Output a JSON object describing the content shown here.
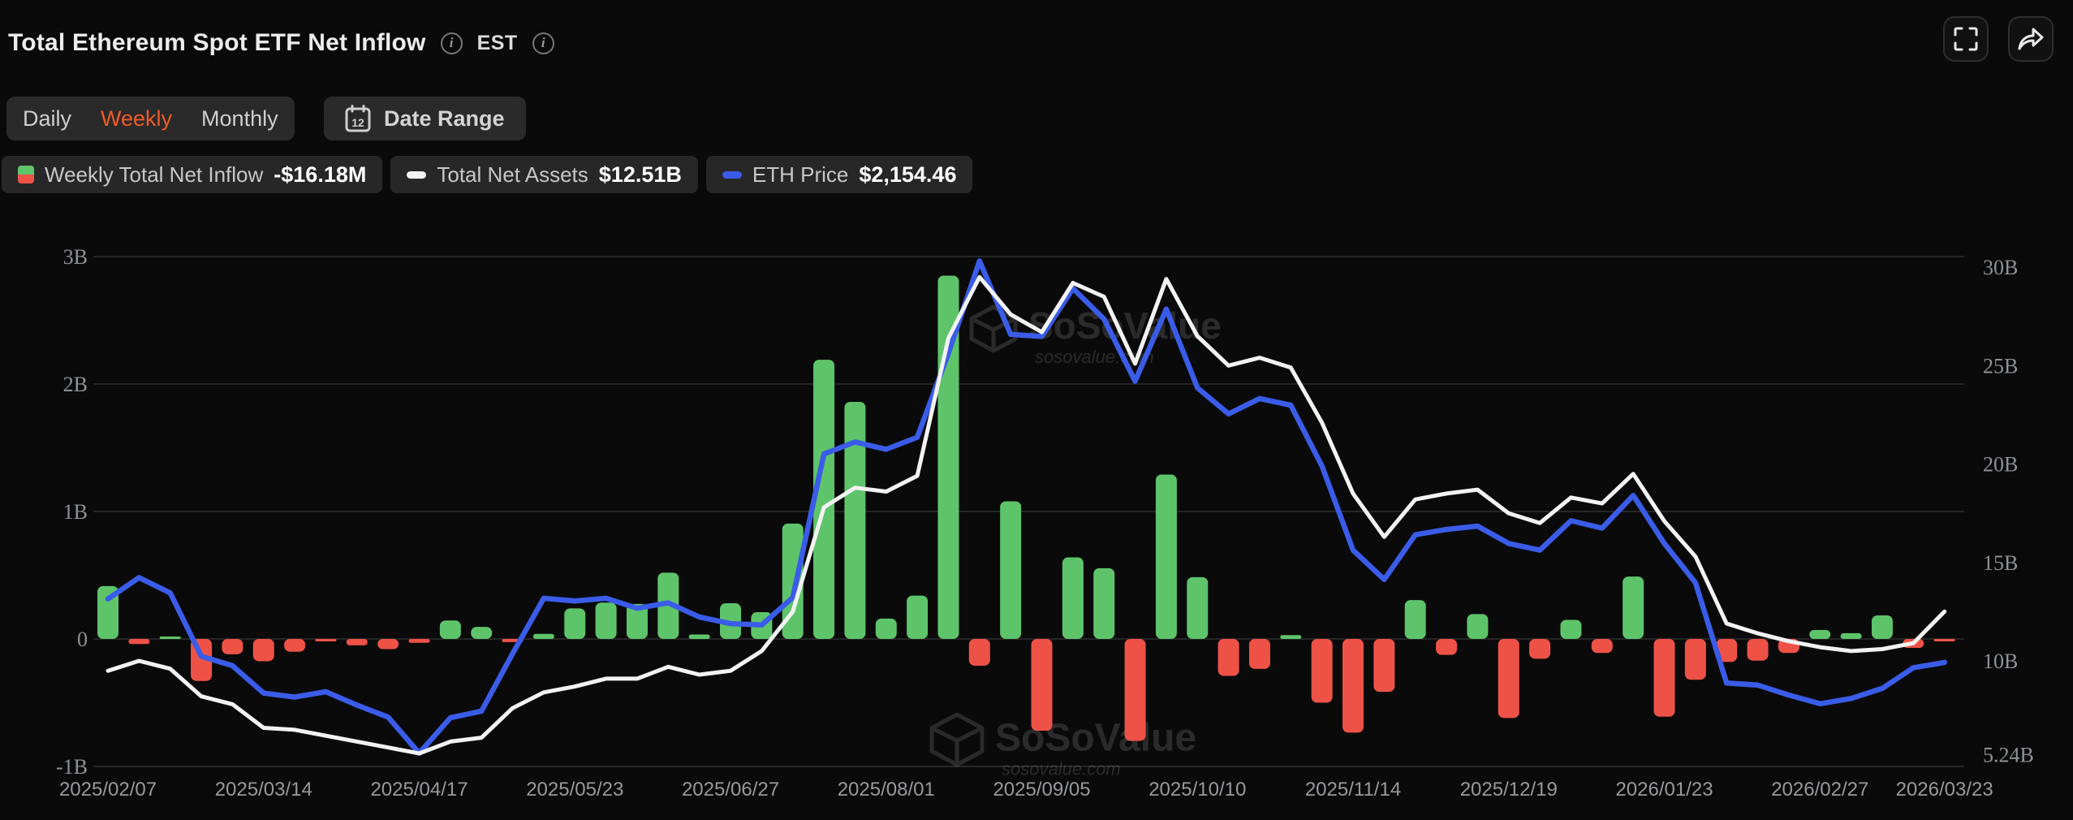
{
  "header": {
    "title": "Total Ethereum Spot ETF Net Inflow",
    "est_label": "EST"
  },
  "toolbar": {
    "tabs": [
      {
        "label": "Daily",
        "active": false
      },
      {
        "label": "Weekly",
        "active": true
      },
      {
        "label": "Monthly",
        "active": false
      }
    ],
    "date_range": {
      "label": "Date Range",
      "calendar_day": "12"
    }
  },
  "legend": {
    "items": [
      {
        "label": "Weekly Total Net Inflow",
        "value": "-$16.18M",
        "swatch": "split-green-red"
      },
      {
        "label": "Total Net Assets",
        "value": "$12.51B",
        "swatch": "white-dash"
      },
      {
        "label": "ETH Price",
        "value": "$2,154.46",
        "swatch": "blue-dash"
      }
    ]
  },
  "watermark": {
    "brand": "SoSoValue",
    "domain": "sosovalue.com"
  },
  "colors": {
    "background": "#0a0a0a",
    "green": "#5ec46a",
    "red": "#ee5247",
    "blue": "#3a5ce8",
    "white_line": "#f2f2f2",
    "grid": "#2e2f31",
    "axis_text": "#8e9296",
    "date_text": "#97999c",
    "orange_active": "#f05a28"
  },
  "chart_data": {
    "type": "bar+line combo, weekly",
    "title": "Total Ethereum Spot ETF Net Inflow (Weekly)",
    "x_unit": "week",
    "n_points": 60,
    "x_tick_labels": [
      {
        "index": 0,
        "label": "2025/02/07"
      },
      {
        "index": 5,
        "label": "2025/03/14"
      },
      {
        "index": 10,
        "label": "2025/04/17"
      },
      {
        "index": 15,
        "label": "2025/05/23"
      },
      {
        "index": 20,
        "label": "2025/06/27"
      },
      {
        "index": 25,
        "label": "2025/08/01"
      },
      {
        "index": 30,
        "label": "2025/09/05"
      },
      {
        "index": 35,
        "label": "2025/10/10"
      },
      {
        "index": 40,
        "label": "2025/11/14"
      },
      {
        "index": 45,
        "label": "2025/12/19"
      },
      {
        "index": 50,
        "label": "2026/01/23"
      },
      {
        "index": 55,
        "label": "2026/02/27"
      },
      {
        "index": 59,
        "label": "2026/03/23"
      }
    ],
    "left_axis": {
      "ticks": [
        "3B",
        "2B",
        "1B",
        "0",
        "-1B"
      ],
      "min_billion": -1,
      "max_billion": 3,
      "grid": true
    },
    "right_axis": {
      "ticks": [
        "30B",
        "25B",
        "20B",
        "15B",
        "10B",
        "5.24B"
      ],
      "min_billion": 4.64,
      "max_billion": 30.54
    },
    "eth_axis_hidden": {
      "min_usd": 1376,
      "max_usd": 5193
    },
    "series": [
      {
        "name": "Weekly Total Net Inflow",
        "type": "bar",
        "unit": "million USD",
        "latest": "-$16.18M",
        "values": [
          415,
          -40,
          8,
          -330,
          -120,
          -175,
          -100,
          -15,
          -50,
          -80,
          -30,
          145,
          95,
          -25,
          40,
          240,
          285,
          275,
          520,
          35,
          280,
          210,
          905,
          2190,
          1860,
          160,
          340,
          2850,
          -210,
          1080,
          -720,
          640,
          555,
          -800,
          1290,
          485,
          -290,
          -235,
          30,
          -500,
          -735,
          -415,
          305,
          -125,
          195,
          -620,
          -155,
          150,
          -110,
          490,
          -610,
          -320,
          -180,
          -170,
          -110,
          70,
          45,
          185,
          -70,
          -16.18
        ]
      },
      {
        "name": "Total Net Assets",
        "type": "line",
        "unit": "billion USD",
        "latest": "$12.51B",
        "values": [
          9.5,
          10.0,
          9.6,
          8.2,
          7.8,
          6.6,
          6.5,
          6.2,
          5.9,
          5.6,
          5.3,
          5.9,
          6.1,
          7.6,
          8.4,
          8.7,
          9.1,
          9.1,
          9.7,
          9.3,
          9.5,
          10.5,
          12.5,
          17.8,
          18.8,
          18.6,
          19.4,
          26.4,
          29.5,
          27.6,
          26.7,
          29.2,
          28.5,
          25.1,
          29.4,
          26.5,
          25.0,
          25.4,
          24.9,
          22.1,
          18.5,
          16.3,
          18.2,
          18.5,
          18.7,
          17.5,
          17.0,
          18.3,
          18.0,
          19.5,
          17.1,
          15.3,
          11.9,
          11.4,
          11.0,
          10.7,
          10.5,
          10.6,
          10.9,
          12.51
        ]
      },
      {
        "name": "ETH Price",
        "type": "line",
        "unit": "USD",
        "latest": "$2,154.46",
        "values": [
          2630,
          2790,
          2675,
          2200,
          2130,
          1925,
          1895,
          1935,
          1835,
          1745,
          1475,
          1740,
          1790,
          2220,
          2635,
          2615,
          2635,
          2560,
          2600,
          2495,
          2445,
          2435,
          2640,
          3715,
          3805,
          3750,
          3840,
          4470,
          5160,
          4610,
          4595,
          4955,
          4725,
          4260,
          4800,
          4210,
          4015,
          4130,
          4080,
          3625,
          2995,
          2775,
          3110,
          3150,
          3175,
          3045,
          2995,
          3215,
          3160,
          3405,
          3045,
          2750,
          2000,
          1985,
          1910,
          1845,
          1885,
          1960,
          2115,
          2154.46
        ]
      }
    ]
  }
}
